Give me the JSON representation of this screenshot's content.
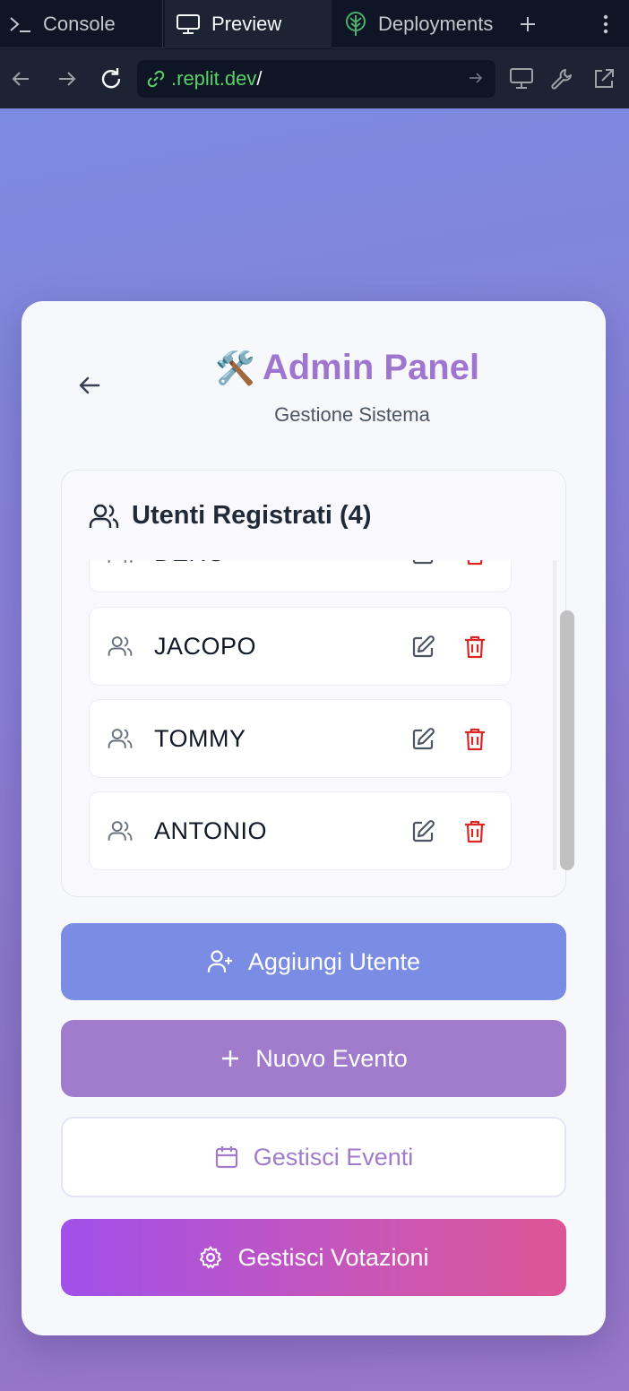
{
  "chrome": {
    "tabs": [
      {
        "label": "Console",
        "icon": "terminal-icon"
      },
      {
        "label": "Preview",
        "icon": "monitor-icon"
      },
      {
        "label": "Deployments",
        "icon": "deploy-tree-icon"
      }
    ],
    "active_tab": "Preview",
    "url": ".replit.dev",
    "url_suffix": "/"
  },
  "header": {
    "emoji": "🛠️",
    "title": "Admin Panel",
    "subtitle": "Gestione Sistema"
  },
  "users": {
    "title": "Utenti Registrati (4)",
    "items": [
      {
        "name": "DERO"
      },
      {
        "name": "JACOPO"
      },
      {
        "name": "TOMMY"
      },
      {
        "name": "ANTONIO"
      }
    ]
  },
  "actions": {
    "add_user": "Aggiungi Utente",
    "new_event": "Nuovo Evento",
    "manage_events": "Gestisci Eventi",
    "manage_votes": "Gestisci Votazioni"
  },
  "colors": {
    "accent_purple": "#9f76cf",
    "add_user_bg": "#7a8ce4",
    "new_event_bg": "#a27ccc",
    "delete_red": "#dc2626",
    "url_green": "#5bd168"
  }
}
